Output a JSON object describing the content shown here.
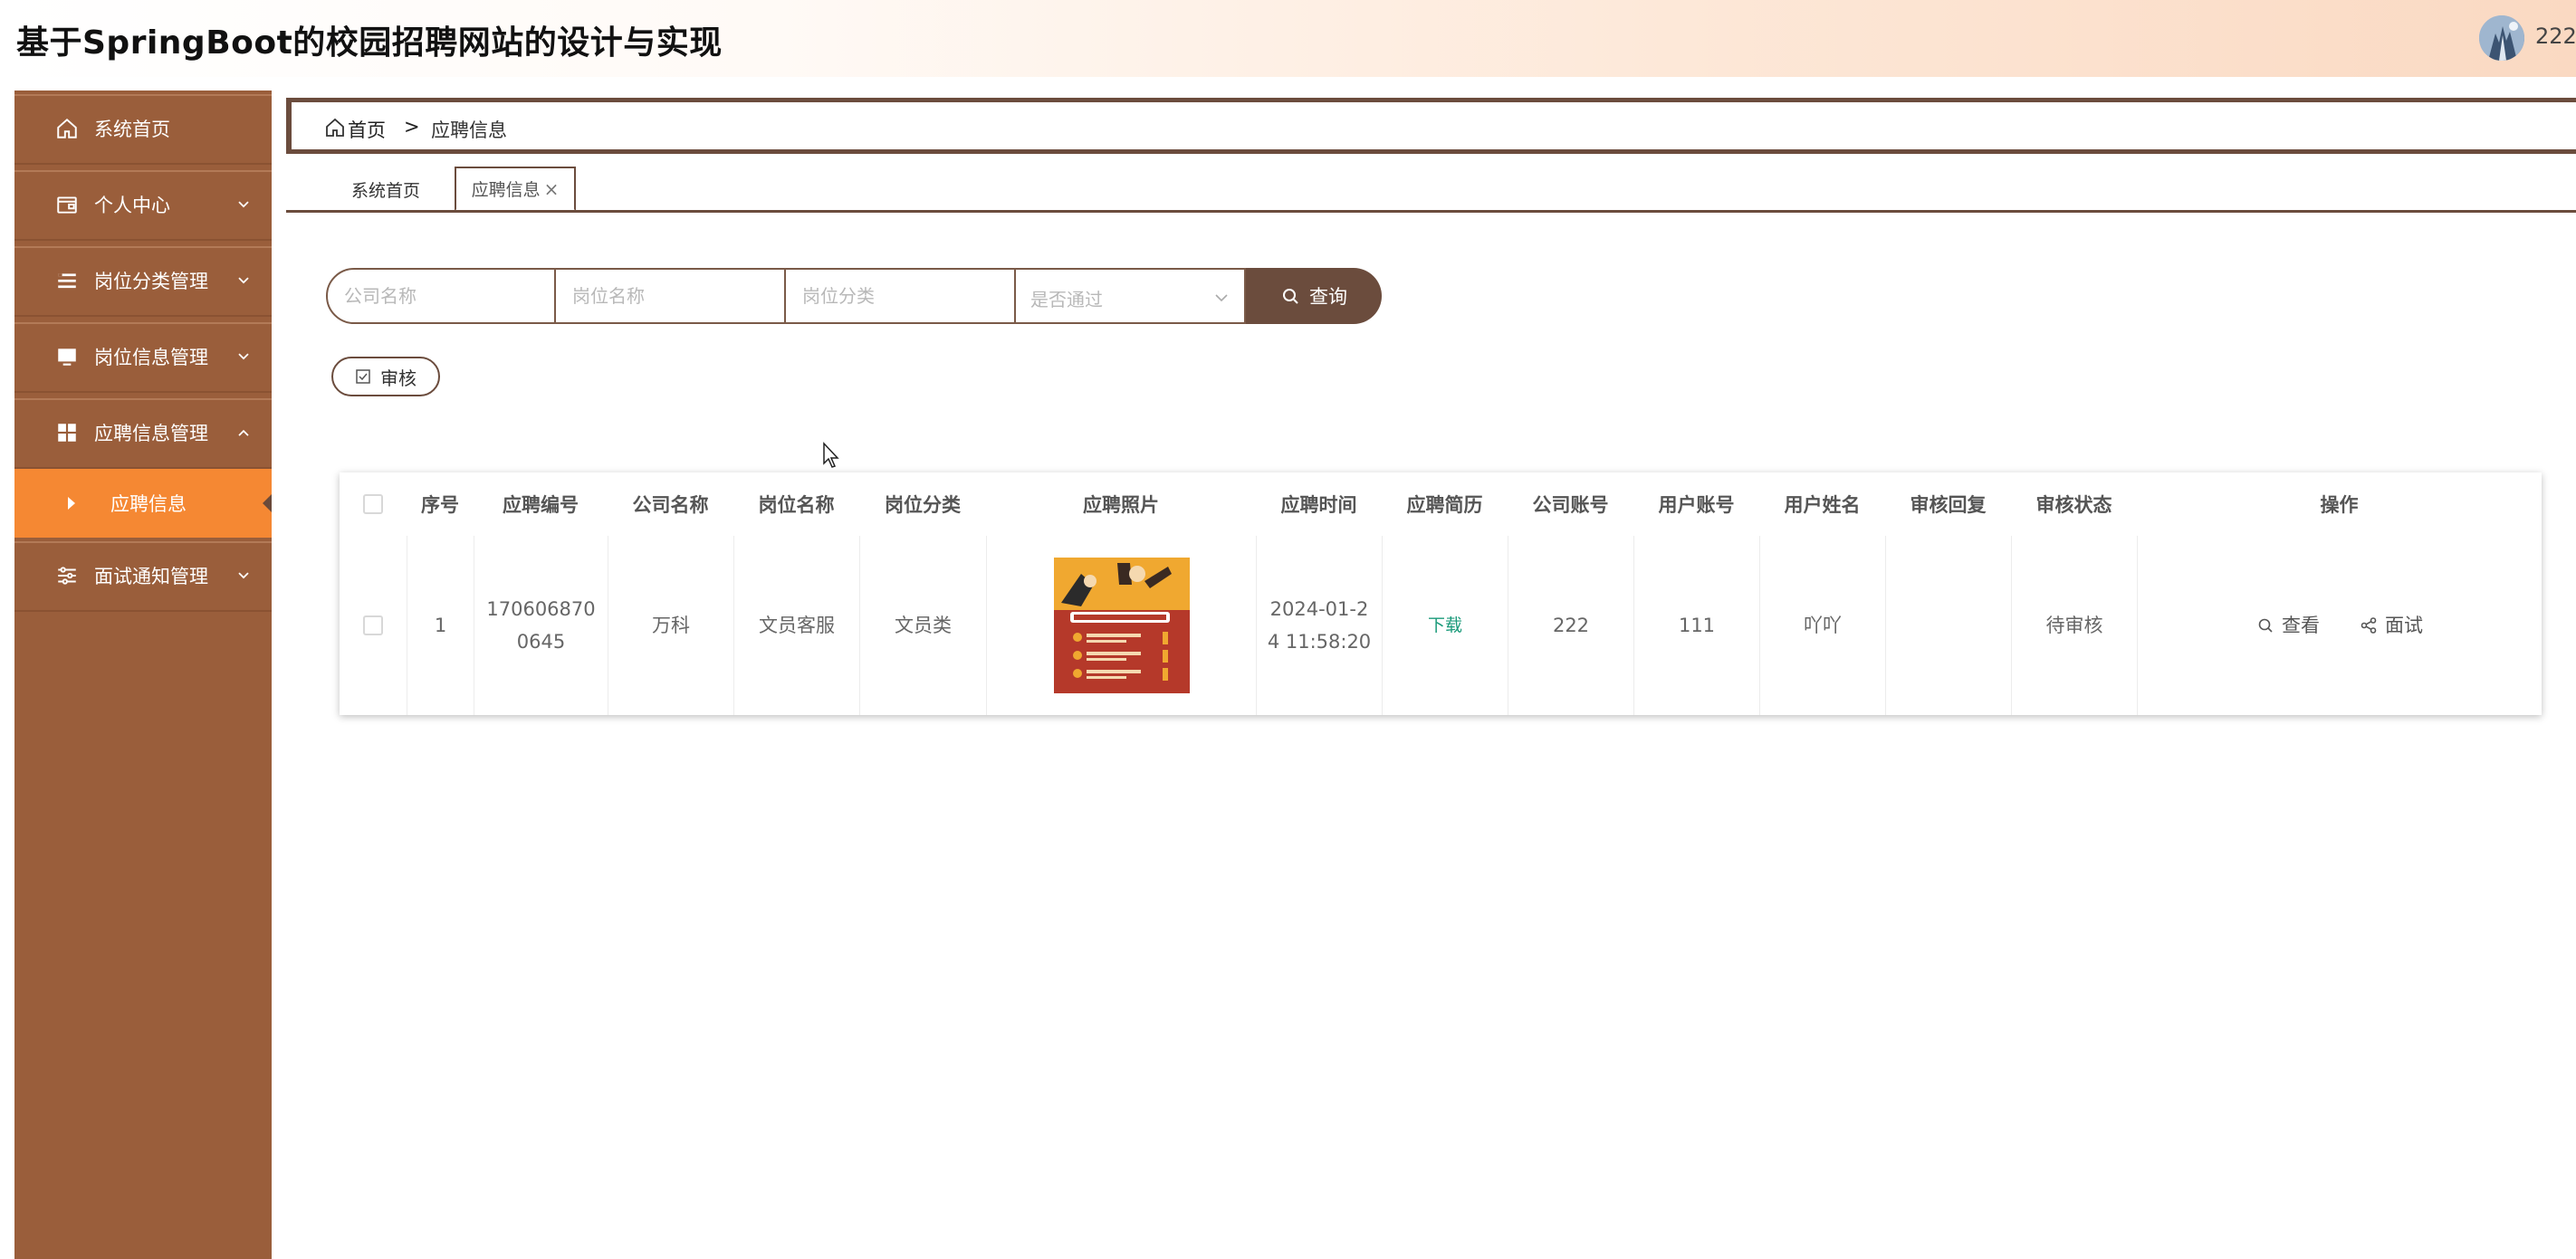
{
  "header": {
    "title": "基于SpringBoot的校园招聘网站的设计与实现",
    "username": "222"
  },
  "sidebar": {
    "items": [
      {
        "label": "系统首页",
        "icon": "home-icon"
      },
      {
        "label": "个人中心",
        "icon": "wallet-icon"
      },
      {
        "label": "岗位分类管理",
        "icon": "list-icon"
      },
      {
        "label": "岗位信息管理",
        "icon": "monitor-icon"
      },
      {
        "label": "应聘信息管理",
        "icon": "grid-icon"
      },
      {
        "label": "面试通知管理",
        "icon": "sliders-icon"
      }
    ],
    "submenu_active": "应聘信息"
  },
  "breadcrumb": {
    "home": "首页",
    "separator": ">",
    "current": "应聘信息"
  },
  "tabs": {
    "home": "系统首页",
    "active": "应聘信息",
    "close": "×"
  },
  "search": {
    "company_placeholder": "公司名称",
    "position_placeholder": "岗位名称",
    "category_placeholder": "岗位分类",
    "passed_placeholder": "是否通过",
    "button_label": "查询"
  },
  "toolbar": {
    "audit_label": "审核"
  },
  "table": {
    "headers": [
      "序号",
      "应聘编号",
      "公司名称",
      "岗位名称",
      "岗位分类",
      "应聘照片",
      "应聘时间",
      "应聘简历",
      "公司账号",
      "用户账号",
      "用户姓名",
      "审核回复",
      "审核状态",
      "操作"
    ],
    "rows": [
      {
        "index": "1",
        "app_no_line1": "170606870",
        "app_no_line2": "0645",
        "company": "万科",
        "position": "文员客服",
        "category": "文员类",
        "time_line1": "2024-01-2",
        "time_line2": "4 11:58:20",
        "resume": "下载",
        "company_account": "222",
        "user_account": "111",
        "user_name": "吖吖",
        "audit_reply": "",
        "audit_status": "待审核",
        "action_view": "查看",
        "action_interview": "面试"
      }
    ]
  },
  "colors": {
    "sidebar_bg": "#9a5e3b",
    "submenu_active_bg": "#f58833",
    "accent_dark": "#6b4c3d",
    "link_green": "#1a9a7a"
  }
}
